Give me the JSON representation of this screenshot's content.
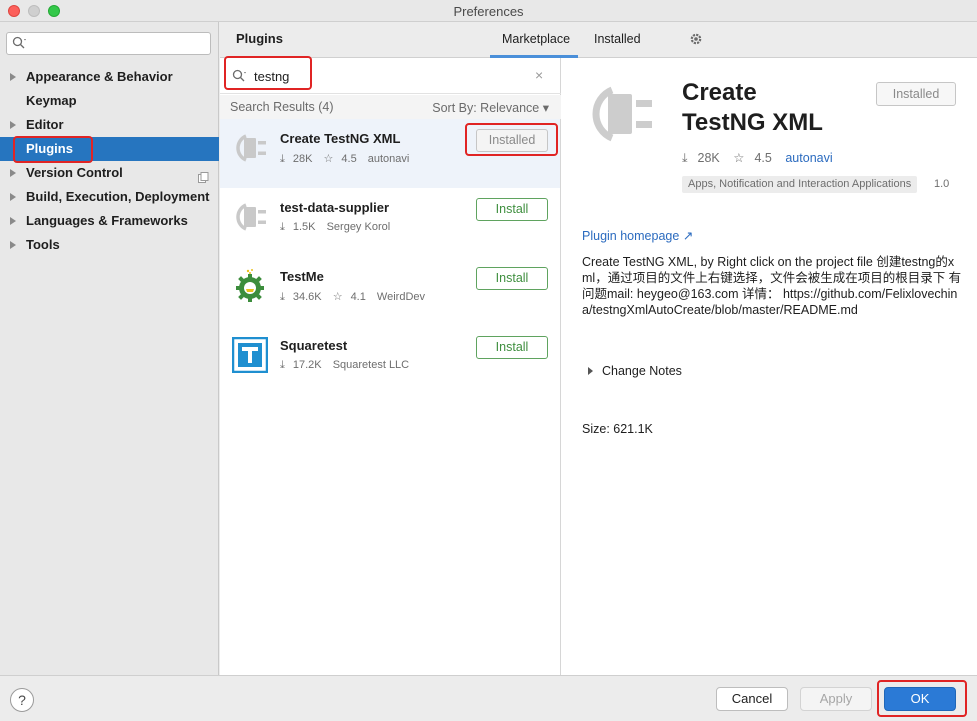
{
  "window": {
    "title": "Preferences"
  },
  "sidebar": {
    "search_placeholder": "",
    "items": [
      {
        "label": "Appearance & Behavior",
        "expandable": true
      },
      {
        "label": "Keymap",
        "expandable": false
      },
      {
        "label": "Editor",
        "expandable": true
      },
      {
        "label": "Plugins",
        "expandable": false,
        "selected": true
      },
      {
        "label": "Version Control",
        "expandable": true
      },
      {
        "label": "Build, Execution, Deployment",
        "expandable": true
      },
      {
        "label": "Languages & Frameworks",
        "expandable": true
      },
      {
        "label": "Tools",
        "expandable": true
      }
    ]
  },
  "header": {
    "title": "Plugins",
    "tabs": [
      {
        "label": "Marketplace",
        "active": true
      },
      {
        "label": "Installed",
        "active": false
      }
    ]
  },
  "search": {
    "value": "testng",
    "clear": "×"
  },
  "results": {
    "count_label": "Search Results (4)",
    "sort_label": "Sort By: Relevance ▾"
  },
  "plugins": [
    {
      "name": "Create TestNG XML",
      "downloads": "28K",
      "rating": "4.5",
      "vendor": "autonavi",
      "button": "Installed",
      "installed": true,
      "icon": "plug-icon"
    },
    {
      "name": "test-data-supplier",
      "downloads": "1.5K",
      "rating": "",
      "vendor": "Sergey Korol",
      "button": "Install",
      "installed": false,
      "icon": "plug-icon"
    },
    {
      "name": "TestMe",
      "downloads": "34.6K",
      "rating": "4.1",
      "vendor": "WeirdDev",
      "button": "Install",
      "installed": false,
      "icon": "testme-gear-icon"
    },
    {
      "name": "Squaretest",
      "downloads": "17.2K",
      "rating": "",
      "vendor": "Squaretest LLC",
      "button": "Install",
      "installed": false,
      "icon": "squaretest-logo-icon"
    }
  ],
  "detail": {
    "title_line1": "Create",
    "title_line2": "TestNG XML",
    "status_button": "Installed",
    "downloads": "28K",
    "rating": "4.5",
    "vendor": "autonavi",
    "tag": "Apps, Notification and Interaction Applications",
    "version": "1.0",
    "homepage": "Plugin homepage ↗",
    "description": "Create TestNG XML, by Right click on the project file 创建testng的xml，通过项目的文件上右键选择，文件会被生成在项目的根目录下 有问题mail: heygeo@163.com 详情： https://github.com/Felixlovechina/testngXmlAutoCreate/blob/master/README.md",
    "change_notes": "Change Notes",
    "size": "Size: 621.1K"
  },
  "footer": {
    "help": "?",
    "cancel": "Cancel",
    "apply": "Apply",
    "ok": "OK"
  },
  "colors": {
    "accent": "#2675bf",
    "install_green": "#3f8f3f",
    "highlight_red": "#e02424",
    "link_blue": "#2b6bbf"
  }
}
